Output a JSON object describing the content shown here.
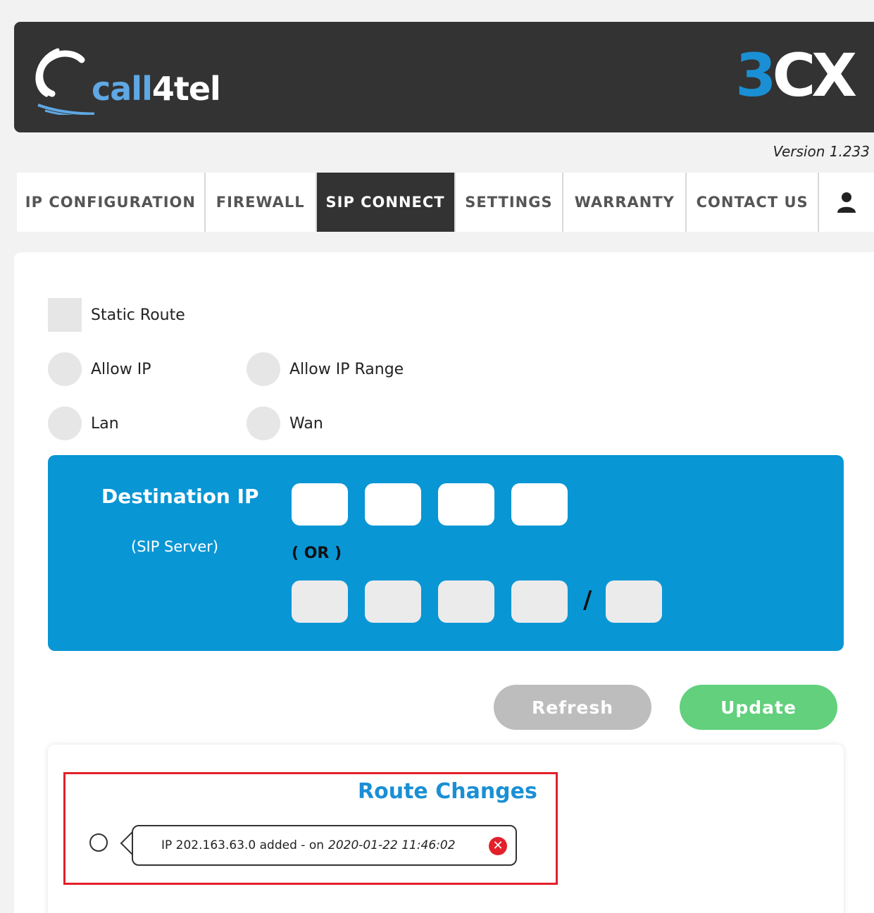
{
  "header": {
    "brand_call": "call",
    "brand_rest": "4tel",
    "product_logo_three": "3",
    "product_logo_cx": "CX",
    "version": "Version 1.233"
  },
  "nav": {
    "tabs": [
      {
        "label": "IP CONFIGURATION",
        "active": false
      },
      {
        "label": "FIREWALL",
        "active": false
      },
      {
        "label": "SIP CONNECT",
        "active": true
      },
      {
        "label": "SETTINGS",
        "active": false
      },
      {
        "label": "WARRANTY",
        "active": false
      },
      {
        "label": "CONTACT US",
        "active": false
      }
    ],
    "user_icon": "user-icon"
  },
  "options": {
    "static_route": "Static Route",
    "allow_ip": "Allow IP",
    "allow_ip_range": "Allow IP Range",
    "lan": "Lan",
    "wan": "Wan"
  },
  "destination": {
    "title": "Destination IP",
    "subtitle": "(SIP Server)",
    "or_label": "( OR )",
    "slash": "/"
  },
  "buttons": {
    "refresh": "Refresh",
    "update": "Update"
  },
  "route_changes": {
    "title": "Route Changes",
    "entries": [
      {
        "text": "IP 202.163.63.0 added - on",
        "timestamp": "2020-01-22 11:46:02"
      }
    ]
  },
  "colors": {
    "header_bg": "#333333",
    "accent_blue": "#0996d4",
    "update_green": "#62d07c",
    "refresh_grey": "#bdbdbd",
    "highlight_red": "#e3202a"
  }
}
